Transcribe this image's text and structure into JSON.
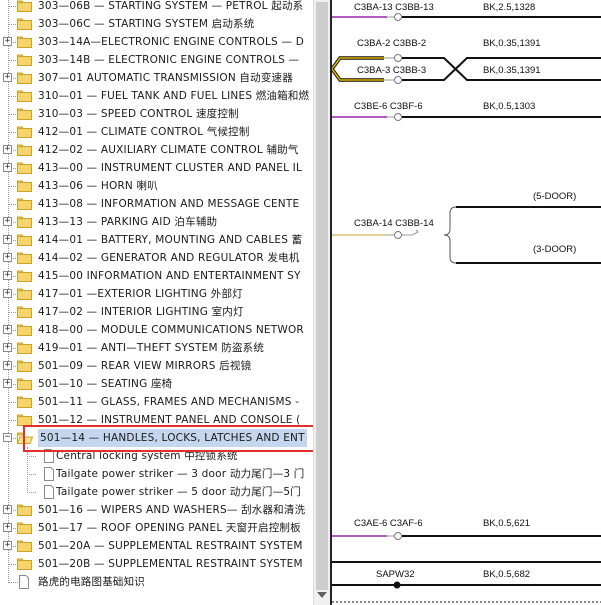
{
  "tree": {
    "items": [
      {
        "text": "303—06B — STARTING SYSTEM — PETROL 起动系",
        "expander": "",
        "icon": "folder",
        "indent": 0
      },
      {
        "text": "303—06C — STARTING SYSTEM 启动系统",
        "expander": "",
        "icon": "folder",
        "indent": 0
      },
      {
        "text": "303—14A—ELECTRONIC ENGINE CONTROLS — D",
        "expander": "+",
        "icon": "folder",
        "indent": 0
      },
      {
        "text": "303—14B — ELECTRONIC ENGINE CONTROLS —",
        "expander": "",
        "icon": "folder",
        "indent": 0
      },
      {
        "text": "307—01 AUTOMATIC TRANSMISSION 自动变速器",
        "expander": "+",
        "icon": "folder",
        "indent": 0
      },
      {
        "text": "310—01 — FUEL TANK AND FUEL LINES 燃油箱和燃",
        "expander": "",
        "icon": "folder",
        "indent": 0
      },
      {
        "text": "310—03 — SPEED CONTROL 速度控制",
        "expander": "",
        "icon": "folder",
        "indent": 0
      },
      {
        "text": "412—01 — CLIMATE CONTROL 气候控制",
        "expander": "",
        "icon": "folder",
        "indent": 0
      },
      {
        "text": "412—02 — AUXILIARY CLIMATE CONTROL 辅助气",
        "expander": "+",
        "icon": "folder",
        "indent": 0
      },
      {
        "text": "413—00 — INSTRUMENT CLUSTER AND PANEL IL",
        "expander": "+",
        "icon": "folder",
        "indent": 0
      },
      {
        "text": "413—06 — HORN 喇叭",
        "expander": "",
        "icon": "folder",
        "indent": 0
      },
      {
        "text": "413—08 — INFORMATION AND MESSAGE CENTE",
        "expander": "",
        "icon": "folder",
        "indent": 0
      },
      {
        "text": "413—13 — PARKING AID 泊车辅助",
        "expander": "+",
        "icon": "folder",
        "indent": 0
      },
      {
        "text": "414—01 — BATTERY, MOUNTING AND CABLES 蓄",
        "expander": "+",
        "icon": "folder",
        "indent": 0
      },
      {
        "text": "414—02 — GENERATOR AND REGULATOR 发电机",
        "expander": "+",
        "icon": "folder",
        "indent": 0
      },
      {
        "text": "415—00 INFORMATION AND ENTERTAINMENT SY",
        "expander": "+",
        "icon": "folder",
        "indent": 0
      },
      {
        "text": "417—01 —EXTERIOR LIGHTING 外部灯",
        "expander": "+",
        "icon": "folder",
        "indent": 0
      },
      {
        "text": "417—02 — INTERIOR LIGHTING 室内灯",
        "expander": "",
        "icon": "folder",
        "indent": 0
      },
      {
        "text": "418—00 — MODULE COMMUNICATIONS NETWOR",
        "expander": "+",
        "icon": "folder",
        "indent": 0
      },
      {
        "text": "419—01 — ANTI—THEFT SYSTEM 防盗系统",
        "expander": "+",
        "icon": "folder",
        "indent": 0
      },
      {
        "text": "501—09 — REAR VIEW MIRRORS 后视镜",
        "expander": "+",
        "icon": "folder",
        "indent": 0
      },
      {
        "text": "501—10 — SEATING 座椅",
        "expander": "+",
        "icon": "folder",
        "indent": 0
      },
      {
        "text": "501—11 — GLASS, FRAMES AND MECHANISMS -",
        "expander": "",
        "icon": "folder",
        "indent": 0
      },
      {
        "text": "501—12 — INSTRUMENT PANEL AND CONSOLE (",
        "expander": "",
        "icon": "folder",
        "indent": 0
      },
      {
        "text": "501—14 — HANDLES, LOCKS, LATCHES AND ENT",
        "expander": "−",
        "icon": "folder",
        "indent": 0,
        "selected": true
      },
      {
        "text": "Central locking system 中控锁系统",
        "expander": "",
        "icon": "doc",
        "indent": 1
      },
      {
        "text": "Tailgate power striker — 3 door 动力尾门—3 门",
        "expander": "",
        "icon": "doc",
        "indent": 1
      },
      {
        "text": "Tailgate power striker — 5 door 动力尾门—5门",
        "expander": "",
        "icon": "doc",
        "indent": 1
      },
      {
        "text": "501—16 — WIPERS AND WASHERS— 刮水器和清洗",
        "expander": "+",
        "icon": "folder",
        "indent": 0
      },
      {
        "text": "501—17 — ROOF OPENING PANEL 天窗开启控制板",
        "expander": "+",
        "icon": "folder",
        "indent": 0
      },
      {
        "text": "501—20A — SUPPLEMENTAL RESTRAINT SYSTEM",
        "expander": "+",
        "icon": "folder",
        "indent": 0
      },
      {
        "text": "501—20B — SUPPLEMENTAL RESTRAINT SYSTEM",
        "expander": "",
        "icon": "folder",
        "indent": 0
      },
      {
        "text": "路虎的电路图基础知识",
        "expander": "",
        "icon": "doc",
        "indent": 0
      }
    ]
  },
  "diagram": {
    "labels": {
      "conn1": "C3BA-13 C3BB-13",
      "wire1": "BK,2.5,1328",
      "conn2": "C3BA-2 C3BB-2",
      "conn3": "C3BA-3 C3BB-3",
      "wire23": "BK,0.35,1391",
      "wire23b": "BK,0.35,1391",
      "conn4": "C3BE-6 C3BF-6",
      "wire4": "BK,0.5,1303",
      "five_door": "(5-DOOR)",
      "conn5": "C3BA-14 C3BB-14",
      "three_door": "(3-DOOR)",
      "conn6": "C3AE-6 C3AF-6",
      "wire6": "BK,0.5,621",
      "splice": "SAPW32",
      "wire7": "BK,0.5,682"
    },
    "colors": {
      "purple_wire": "#b35bc0",
      "yellow_wire": "#e0b400",
      "tan_wire": "#d8c27a",
      "black_wire": "#111111",
      "highlight": "#e0302c"
    }
  }
}
